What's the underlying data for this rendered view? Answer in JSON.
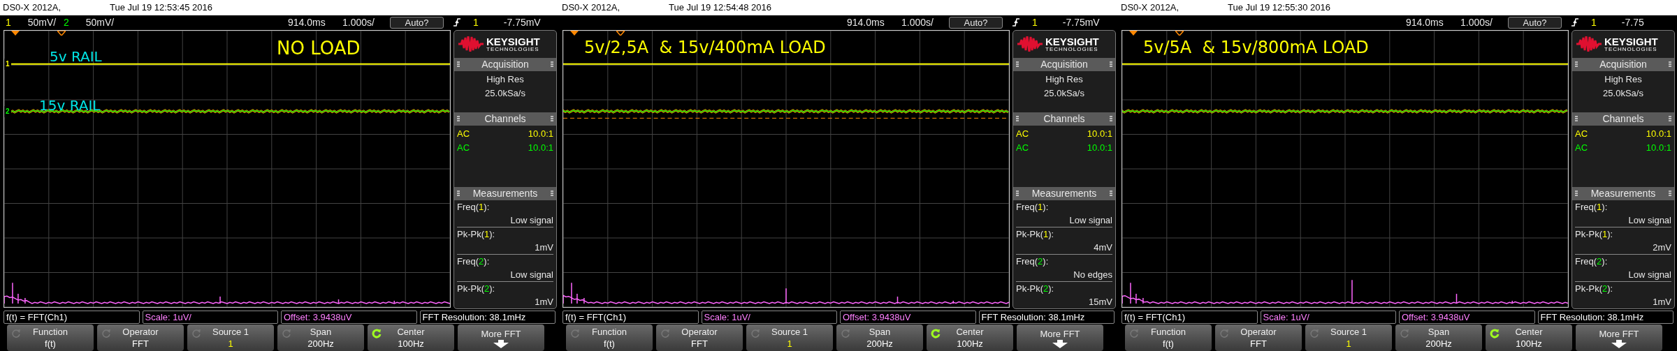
{
  "screens": [
    {
      "model": "DS0-X 2012A,",
      "timestamp": "Tue Jul 19 12:53:45 2016",
      "channel_scales": [
        {
          "channel": "1",
          "scale": "50mV/",
          "color": "#ffff00"
        },
        {
          "channel": "2",
          "scale": "50mV/",
          "color": "#00ff00"
        }
      ],
      "delay": "914.0ms",
      "timebase": "1.000s/",
      "trigger_mode": "Auto?",
      "trigger_source": "1",
      "trigger_level": "-7.75mV",
      "annotations": [
        {
          "text": "NO LOAD",
          "color": "#ffff00"
        },
        {
          "text": "5v RAIL",
          "color": "#00e5e5"
        },
        {
          "text": "15v RAIL",
          "color": "#00e5e5"
        }
      ],
      "trace_markers": [
        {
          "label": "1",
          "color": "#ffff00"
        },
        {
          "label": "2",
          "color": "#00ff00"
        }
      ],
      "reference_line": false,
      "sidebar": {
        "brand": "KEYSIGHT",
        "brand_sub": "TECHNOLOGIES",
        "acquisition_title": "Acquisition",
        "acquisition": [
          "High Res",
          "25.0kSa/s"
        ],
        "channels_title": "Channels",
        "channels": [
          {
            "coupling": "AC",
            "probe": "10.0:1",
            "color": "#ffff00"
          },
          {
            "coupling": "AC",
            "probe": "10.0:1",
            "color": "#00ff00"
          }
        ],
        "measurements_title": "Measurements",
        "measurements": [
          {
            "before": "Freq(",
            "channel": "1",
            "after": "):",
            "value": "Low signal",
            "color": "#ffff00"
          },
          {
            "before": "Pk-Pk(",
            "channel": "1",
            "after": "):",
            "value": "1mV",
            "color": "#ffff00"
          },
          {
            "before": "Freq(",
            "channel": "2",
            "after": "):",
            "value": "Low signal",
            "color": "#00ff00"
          },
          {
            "before": "Pk-Pk(",
            "channel": "2",
            "after": "):",
            "value": "1mV",
            "color": "#00ff00"
          }
        ]
      },
      "info": [
        {
          "text": "f(t) = FFT(Ch1)",
          "color": "#ffffff"
        },
        {
          "text": "Scale: 1uV/",
          "color": "#ff80ff"
        },
        {
          "text": "Offset: 3.9438uV",
          "color": "#ff80ff"
        },
        {
          "text": "FFT Resolution: 38.1mHz",
          "color": "#ffffff"
        }
      ],
      "softkeys": [
        {
          "kind": "knob",
          "label": "Function",
          "value": "f(t)",
          "active": false,
          "color": "#ffffff"
        },
        {
          "kind": "knob",
          "label": "Operator",
          "value": "FFT",
          "active": false,
          "color": "#ffffff"
        },
        {
          "kind": "knob",
          "label": "Source 1",
          "value": "1",
          "active": false,
          "color": "#ffff00"
        },
        {
          "kind": "knob",
          "label": "Span",
          "value": "200Hz",
          "active": false,
          "color": "#ffffff"
        },
        {
          "kind": "knob",
          "label": "Center",
          "value": "100Hz",
          "active": true,
          "color": "#ffffff"
        },
        {
          "kind": "menu",
          "label": "More FFT"
        }
      ]
    },
    {
      "model": "DS0-X 2012A,",
      "timestamp": "Tue Jul 19 12:54:48 2016",
      "delay": "914.0ms",
      "timebase": "1.000s/",
      "trigger_mode": "Auto?",
      "trigger_source": "1",
      "trigger_level": "-7.75mV",
      "annotations": [
        {
          "text": "5v/2,5A  & 15v/400mA LOAD",
          "color": "#ffff00"
        }
      ],
      "reference_line": true,
      "sidebar": {
        "brand": "KEYSIGHT",
        "brand_sub": "TECHNOLOGIES",
        "acquisition_title": "Acquisition",
        "acquisition": [
          "High Res",
          "25.0kSa/s"
        ],
        "channels_title": "Channels",
        "channels": [
          {
            "coupling": "AC",
            "probe": "10.0:1",
            "color": "#ffff00"
          },
          {
            "coupling": "AC",
            "probe": "10.0:1",
            "color": "#00ff00"
          }
        ],
        "measurements_title": "Measurements",
        "measurements": [
          {
            "before": "Freq(",
            "channel": "1",
            "after": "):",
            "value": "Low signal",
            "color": "#ffff00"
          },
          {
            "before": "Pk-Pk(",
            "channel": "1",
            "after": "):",
            "value": "4mV",
            "color": "#ffff00"
          },
          {
            "before": "Freq(",
            "channel": "2",
            "after": "):",
            "value": "No edges",
            "color": "#00ff00"
          },
          {
            "before": "Pk-Pk(",
            "channel": "2",
            "after": "):",
            "value": "15mV",
            "color": "#00ff00"
          }
        ]
      },
      "info": [
        {
          "text": "f(t) = FFT(Ch1)",
          "color": "#ffffff"
        },
        {
          "text": "Scale: 1uV/",
          "color": "#ff80ff"
        },
        {
          "text": "Offset: 3.9438uV",
          "color": "#ff80ff"
        },
        {
          "text": "FFT Resolution: 38.1mHz",
          "color": "#ffffff"
        }
      ],
      "softkeys": [
        {
          "kind": "knob",
          "label": "Function",
          "value": "f(t)",
          "active": false,
          "color": "#ffffff"
        },
        {
          "kind": "knob",
          "label": "Operator",
          "value": "FFT",
          "active": false,
          "color": "#ffffff"
        },
        {
          "kind": "knob",
          "label": "Source 1",
          "value": "1",
          "active": false,
          "color": "#ffff00"
        },
        {
          "kind": "knob",
          "label": "Span",
          "value": "200Hz",
          "active": false,
          "color": "#ffffff"
        },
        {
          "kind": "knob",
          "label": "Center",
          "value": "100Hz",
          "active": true,
          "color": "#ffffff"
        },
        {
          "kind": "menu",
          "label": "More FFT"
        }
      ]
    },
    {
      "model": "DS0-X 2012A,",
      "timestamp": "Tue Jul 19 12:55:30 2016",
      "delay": "914.0ms",
      "timebase": "1.000s/",
      "trigger_mode": "Auto?",
      "trigger_source": "1",
      "trigger_level": "-7.75",
      "annotations": [
        {
          "text": "5v/5A  & 15v/800mA LOAD",
          "color": "#ffff00"
        }
      ],
      "reference_line": false,
      "sidebar": {
        "brand": "KEYSIGHT",
        "brand_sub": "TECHNOLOGIES",
        "acquisition_title": "Acquisition",
        "acquisition": [
          "High Res",
          "25.0kSa/s"
        ],
        "channels_title": "Channels",
        "channels": [
          {
            "coupling": "AC",
            "probe": "10.0:1",
            "color": "#ffff00"
          },
          {
            "coupling": "AC",
            "probe": "10.0:1",
            "color": "#00ff00"
          }
        ],
        "measurements_title": "Measurements",
        "measurements": [
          {
            "before": "Freq(",
            "channel": "1",
            "after": "):",
            "value": "Low signal",
            "color": "#ffff00"
          },
          {
            "before": "Pk-Pk(",
            "channel": "1",
            "after": "):",
            "value": "2mV",
            "color": "#ffff00"
          },
          {
            "before": "Freq(",
            "channel": "2",
            "after": "):",
            "value": "Low signal",
            "color": "#00ff00"
          },
          {
            "before": "Pk-Pk(",
            "channel": "2",
            "after": "):",
            "value": "1mV",
            "color": "#00ff00"
          }
        ]
      },
      "info": [
        {
          "text": "f(t) = FFT(Ch1)",
          "color": "#ffffff"
        },
        {
          "text": "Scale: 1uV/",
          "color": "#ff80ff"
        },
        {
          "text": "Offset: 3.9438uV",
          "color": "#ff80ff"
        },
        {
          "text": "FFT Resolution: 38.1mHz",
          "color": "#ffffff"
        }
      ],
      "softkeys": [
        {
          "kind": "knob",
          "label": "Function",
          "value": "f(t)",
          "active": false,
          "color": "#ffffff"
        },
        {
          "kind": "knob",
          "label": "Operator",
          "value": "FFT",
          "active": false,
          "color": "#ffffff"
        },
        {
          "kind": "knob",
          "label": "Source 1",
          "value": "1",
          "active": false,
          "color": "#ffff00"
        },
        {
          "kind": "knob",
          "label": "Span",
          "value": "200Hz",
          "active": false,
          "color": "#ffffff"
        },
        {
          "kind": "knob",
          "label": "Center",
          "value": "100Hz",
          "active": true,
          "color": "#ffffff"
        },
        {
          "kind": "menu",
          "label": "More FFT"
        }
      ]
    }
  ]
}
